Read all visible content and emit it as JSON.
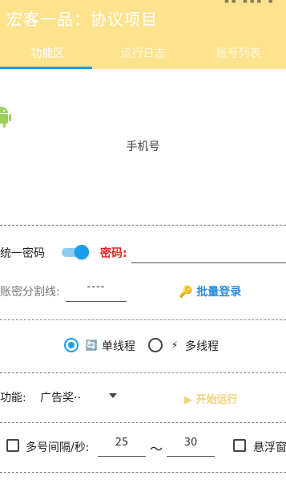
{
  "app": {
    "title": "宏客一品：协议项目",
    "status_glyphs": "▮▮ ▮▮▮ ▮"
  },
  "tabs": [
    {
      "label": "功能区",
      "active": true
    },
    {
      "label": "运行日志",
      "active": false
    },
    {
      "label": "账号列表",
      "active": false
    }
  ],
  "main": {
    "phone_label": "手机号",
    "unified_pwd_label": "统一密码",
    "unified_pwd_toggle_on": true,
    "password_label": "密码:",
    "password_value": "",
    "sep_label": "账密分割线:",
    "sep_value": "----",
    "batch_login_label": "批量登录",
    "single_thread_label": "单线程",
    "multi_thread_label": "多线程",
    "thread_mode": "single",
    "func_label": "功能:",
    "func_selected": "广告奖··",
    "start_label": "开始运行",
    "interval_label": "多号间隔/秒:",
    "interval_min": "25",
    "interval_tilde": "～",
    "interval_max": "30",
    "floating_label": "悬浮窗"
  },
  "icons": {
    "key": "🔑",
    "refresh": "🔄",
    "bolt": "⚡",
    "play": "▶"
  },
  "colors": {
    "header": "#fde38d",
    "accent": "#1a9eea",
    "password_label": "#e32424",
    "batch_login": "#2a8ee0",
    "start_disabled": "#f2d27a"
  }
}
